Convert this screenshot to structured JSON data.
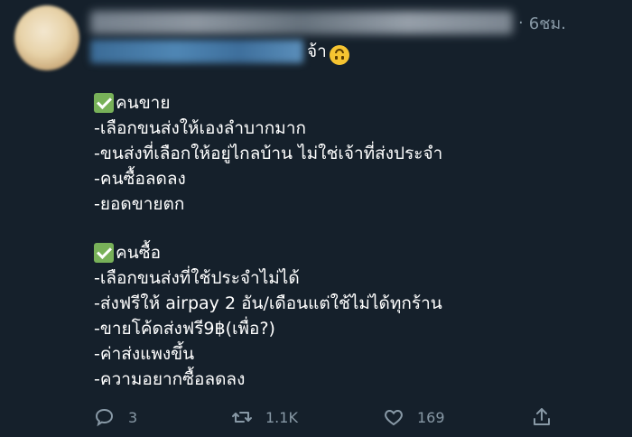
{
  "header": {
    "timestamp": "6ชม.",
    "dot": "·",
    "more": "···"
  },
  "mention_suffix": "จ้า",
  "sections": [
    {
      "title": "คนขาย",
      "lines": [
        "-เลือกขนส่งให้เองลำบากมาก",
        "-ขนส่งที่เลือกให้อยู่ไกลบ้าน ไม่ใช่เจ้าที่ส่งประจำ",
        "-คนซื้อลดลง",
        "-ยอดขายตก"
      ]
    },
    {
      "title": "คนซื้อ",
      "lines": [
        "-เลือกขนส่งที่ใช้ประจำไม่ได้",
        "-ส่งฟรีให้ airpay 2 อัน/เดือนแต่ใช้ไม่ได้ทุกร้าน",
        "-ขายโค้ดส่งฟรี9฿(เพื่อ?)",
        "-ค่าส่งแพงขึ้น",
        "-ความอยากซื้อลดลง"
      ]
    }
  ],
  "actions": {
    "reply_count": "3",
    "retweet_count": "1.1K",
    "like_count": "169"
  },
  "colors": {
    "background": "#15202b",
    "muted": "#8899a6",
    "check": "#78b159"
  },
  "icons": [
    "reply-icon",
    "retweet-icon",
    "like-icon",
    "share-icon",
    "check-mark-icon",
    "upside-down-face-emoji"
  ]
}
